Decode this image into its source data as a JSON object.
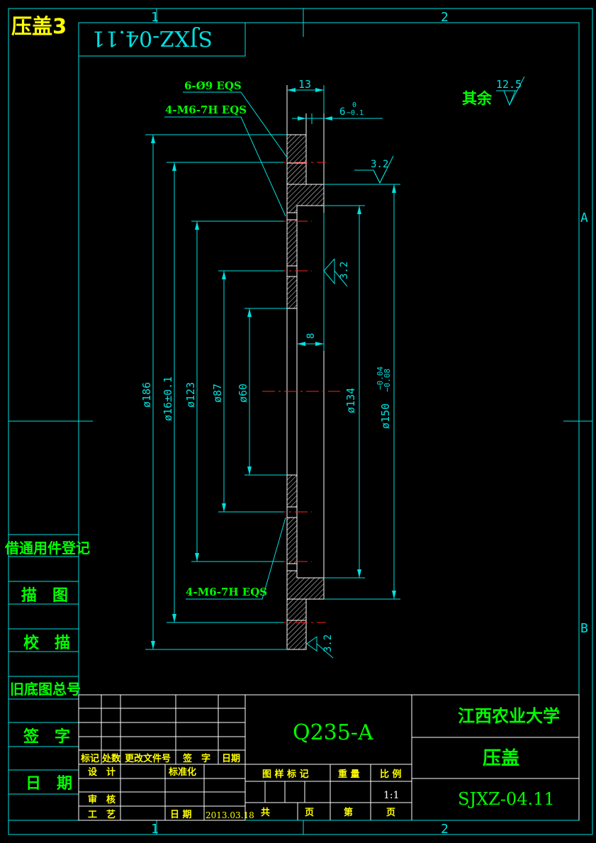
{
  "header": {
    "sheet_title": "压盖3",
    "mirror_code": "SJXZ-04.11"
  },
  "zones": {
    "top": [
      "1",
      "2"
    ],
    "bottom": [
      "1",
      "2"
    ],
    "right": [
      "A",
      "B"
    ]
  },
  "roughness": {
    "rest_label": "其余",
    "rest_value": "12.5",
    "values": [
      "3.2",
      "3.2",
      "3.2"
    ]
  },
  "callouts": {
    "holes_6": "6-Ø9 EQS",
    "threads_top": "4-M6-7H EQS",
    "threads_bottom": "4-M6-7H EQS"
  },
  "dimensions": {
    "width_top": "13",
    "width_step": "6",
    "width_step_tol_upper": "0",
    "width_step_tol_lower": "−0.1",
    "gap": "8",
    "d186": "ø186",
    "d160": "ø16±0.1",
    "d123": "ø123",
    "d87": "ø87",
    "d60": "ø60",
    "d134": "ø134",
    "d150": "ø150",
    "d150_tol_upper": "−0.04",
    "d150_tol_lower": "−0.08"
  },
  "side_column": {
    "labels": [
      "借通用件登记",
      "描　图",
      "校　描",
      "旧底图总号",
      "签　字",
      "日　期"
    ]
  },
  "title_block": {
    "material": "Q235-A",
    "school": "江西农业大学",
    "part_name": "压盖",
    "drawing_no": "SJXZ-04.11",
    "rev_headers": [
      "标记",
      "处数",
      "更改文件号",
      "签　字",
      "日期"
    ],
    "designer": "设　计",
    "standardization": "标准化",
    "reviewer": "审　核",
    "process": "工　艺",
    "date_label": "日 期",
    "date": "2013.03.18",
    "stage_label": "图 样 标 记",
    "weight_label": "重 量",
    "scale_label": "比 例",
    "scale": "1:1",
    "total_label": "共",
    "sheets_label": "页",
    "sheet_label": "第",
    "page_label": "页"
  }
}
